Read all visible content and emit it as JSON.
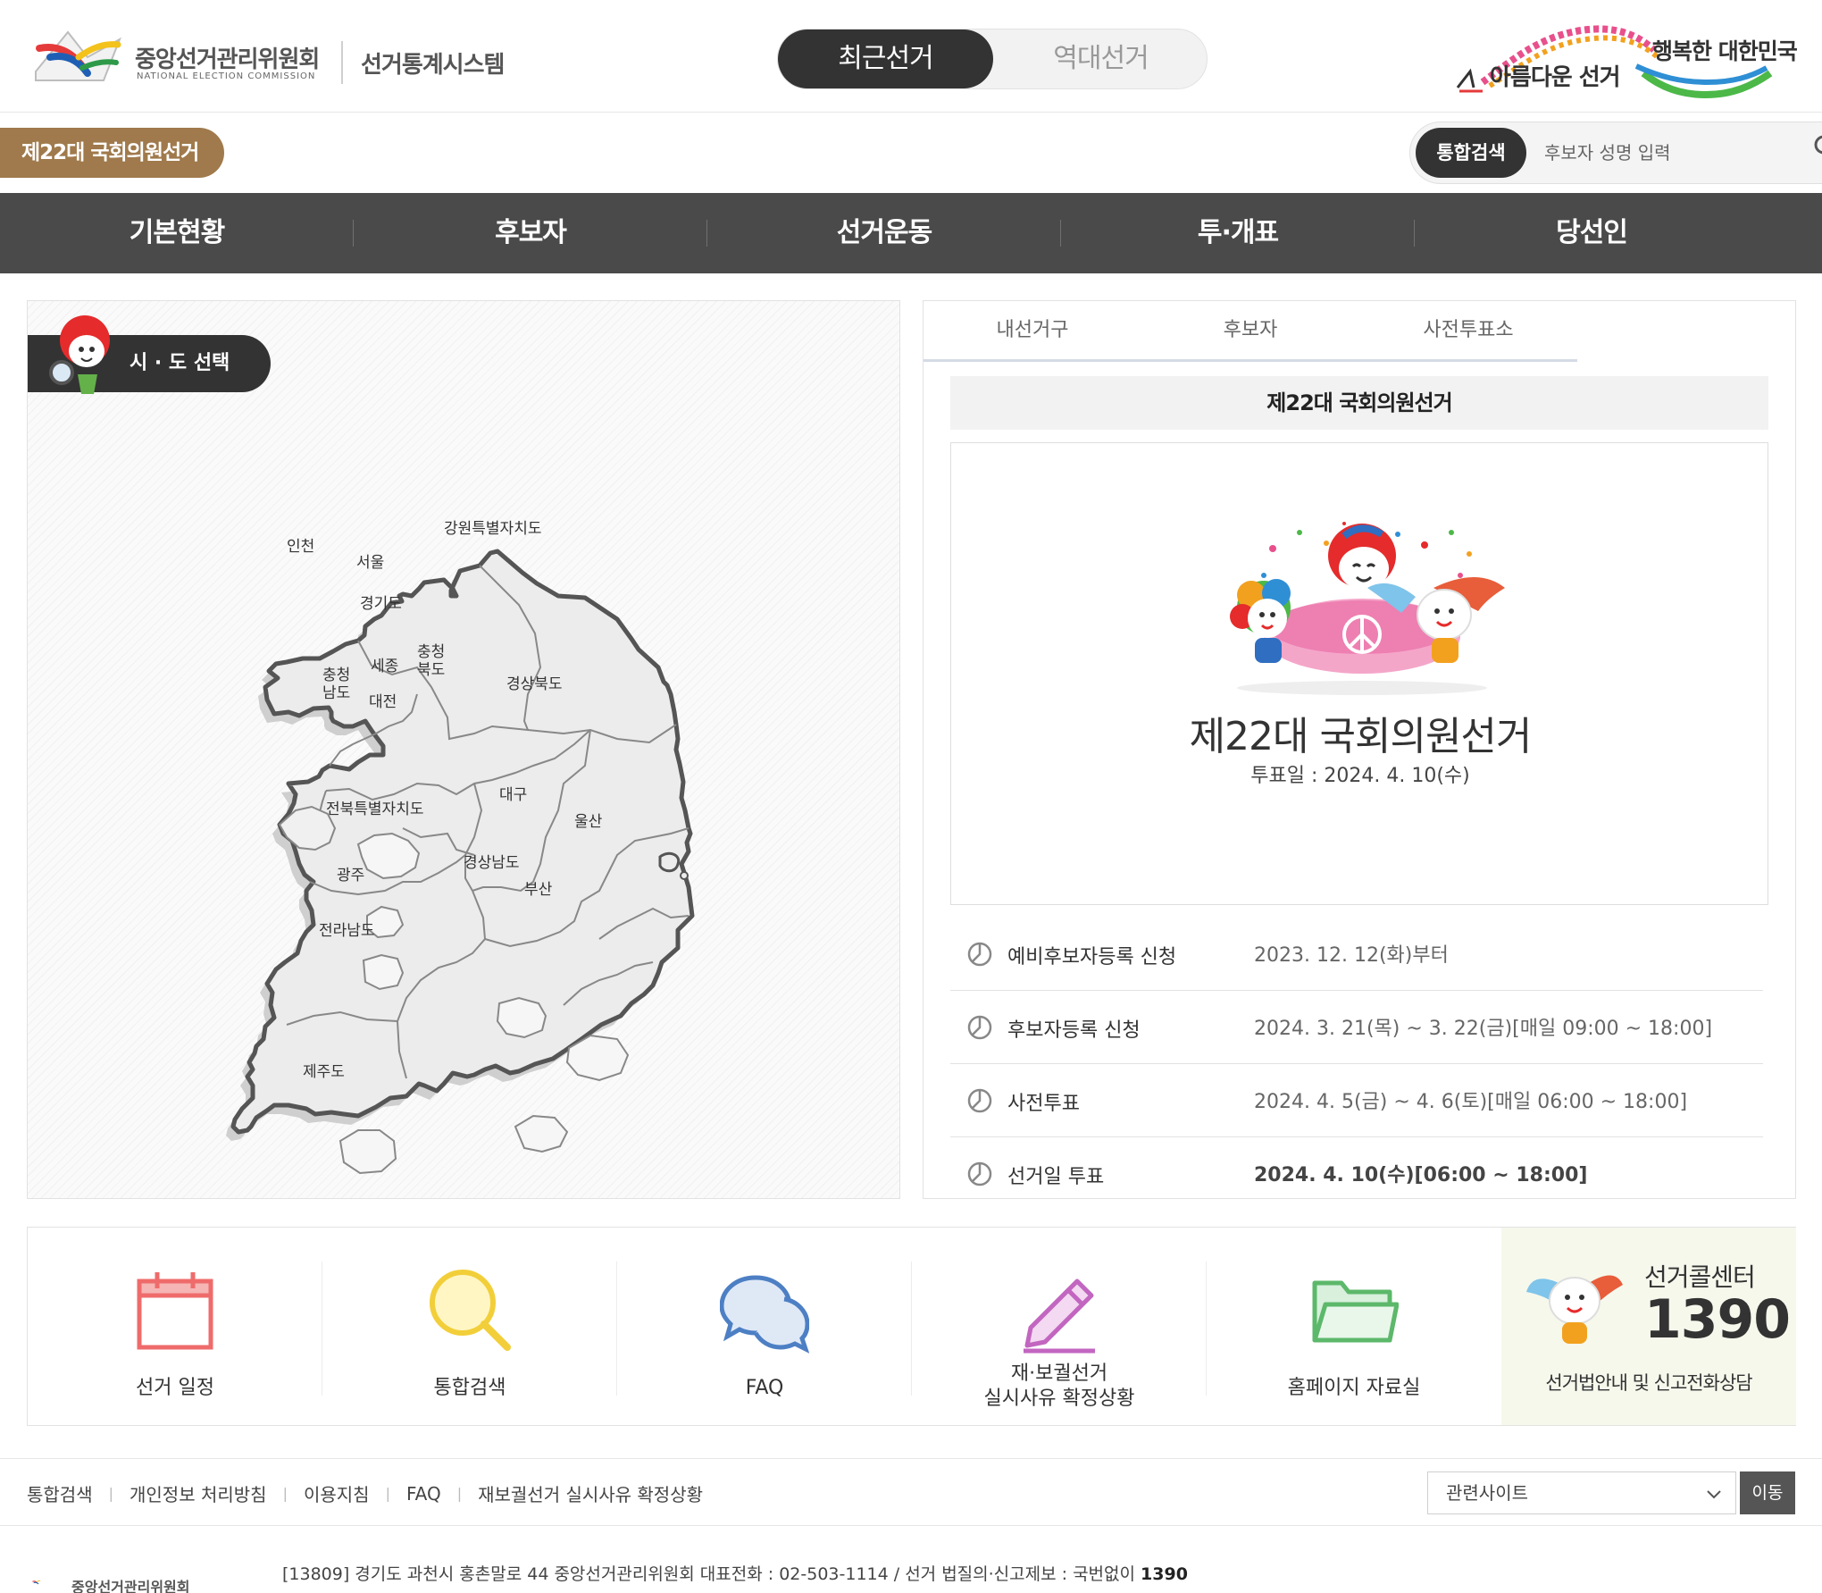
{
  "header": {
    "org_name": "중앙선거관리위원회",
    "org_sub": "NATIONAL ELECTION COMMISSION",
    "system_name": "선거통계시스템",
    "toggle": {
      "recent": "최근선거",
      "past": "역대선거"
    },
    "slogan_top": "행복한 대한민국",
    "slogan_bottom": "아름다운 선거"
  },
  "subbar": {
    "election_badge": "제22대 국회의원선거",
    "search_tab": "통합검색",
    "search_placeholder": "후보자 성명 입력"
  },
  "gnb": [
    "기본현황",
    "후보자",
    "선거운동",
    "투·개표",
    "당선인"
  ],
  "map": {
    "title": "시 · 도 선택",
    "regions": {
      "incheon": "인천",
      "seoul": "서울",
      "gyeonggi": "경기도",
      "gangwon": "강원특별자치도",
      "chungbuk_1": "충청",
      "chungbuk_2": "북도",
      "chungnam_1": "충청",
      "chungnam_2": "남도",
      "sejong": "세종",
      "daejeon": "대전",
      "gyeongbuk": "경상북도",
      "daegu": "대구",
      "jeonbuk": "전북특별자치도",
      "ulsan": "울산",
      "gwangju": "광주",
      "gyeongnam": "경상남도",
      "busan": "부산",
      "jeonnam": "전라남도",
      "jeju": "제주도"
    }
  },
  "info": {
    "tabs": [
      "내선거구",
      "후보자",
      "사전투표소"
    ],
    "title_bar": "제22대 국회의원선거",
    "poster_title": "제22대 국회의원선거",
    "poster_date": "투표일 : 2024. 4. 10(수)",
    "schedule": [
      {
        "label": "예비후보자등록 신청",
        "value": "2023. 12. 12(화)부터"
      },
      {
        "label": "후보자등록 신청",
        "value": "2024. 3. 21(목) ~ 3. 22(금)[매일 09:00 ~ 18:00]"
      },
      {
        "label": "사전투표",
        "value": "2024. 4. 5(금) ~ 4. 6(토)[매일 06:00 ~ 18:00]"
      },
      {
        "label": "선거일 투표",
        "value": "2024. 4. 10(수)[06:00 ~ 18:00]"
      }
    ]
  },
  "quick": {
    "schedule": "선거 일정",
    "search": "통합검색",
    "faq": "FAQ",
    "reelection_1": "재·보궐선거",
    "reelection_2": "실시사유 확정상황",
    "archive": "홈페이지 자료실",
    "callcenter_title": "선거콜센터",
    "callcenter_number": "1390",
    "callcenter_desc": "선거법안내 및 신고전화상담"
  },
  "footer": {
    "links": [
      "통합검색",
      "개인정보 처리방침",
      "이용지침",
      "FAQ",
      "재보궐선거 실시사유 확정상황"
    ],
    "related_sites": "관련사이트",
    "go": "이동",
    "address": "[13809] 경기도 과천시 홍촌말로 44 중앙선거관리위원회 대표전화 : 02-503-1114 / 선거 법질의·신고제보 : 국번없이 ",
    "address_emph": "1390",
    "logo_text": "중앙선거관리위원회"
  },
  "colors": {
    "gnb_bg": "#4a4a4a",
    "badge": "#a07a4c",
    "toggle_active": "#333333"
  }
}
